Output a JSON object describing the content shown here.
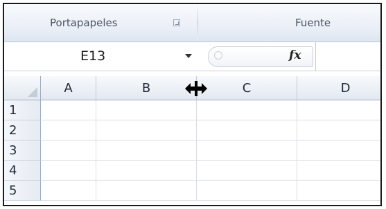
{
  "ribbon": {
    "groups": [
      {
        "label": "Portapapeles"
      },
      {
        "label": "Fuente"
      }
    ]
  },
  "formula_bar": {
    "name_box_value": "E13",
    "fx_label": "fx",
    "formula_value": ""
  },
  "sheet": {
    "columns": [
      "A",
      "B",
      "C",
      "D"
    ],
    "rows": [
      "1",
      "2",
      "3",
      "4",
      "5"
    ]
  }
}
